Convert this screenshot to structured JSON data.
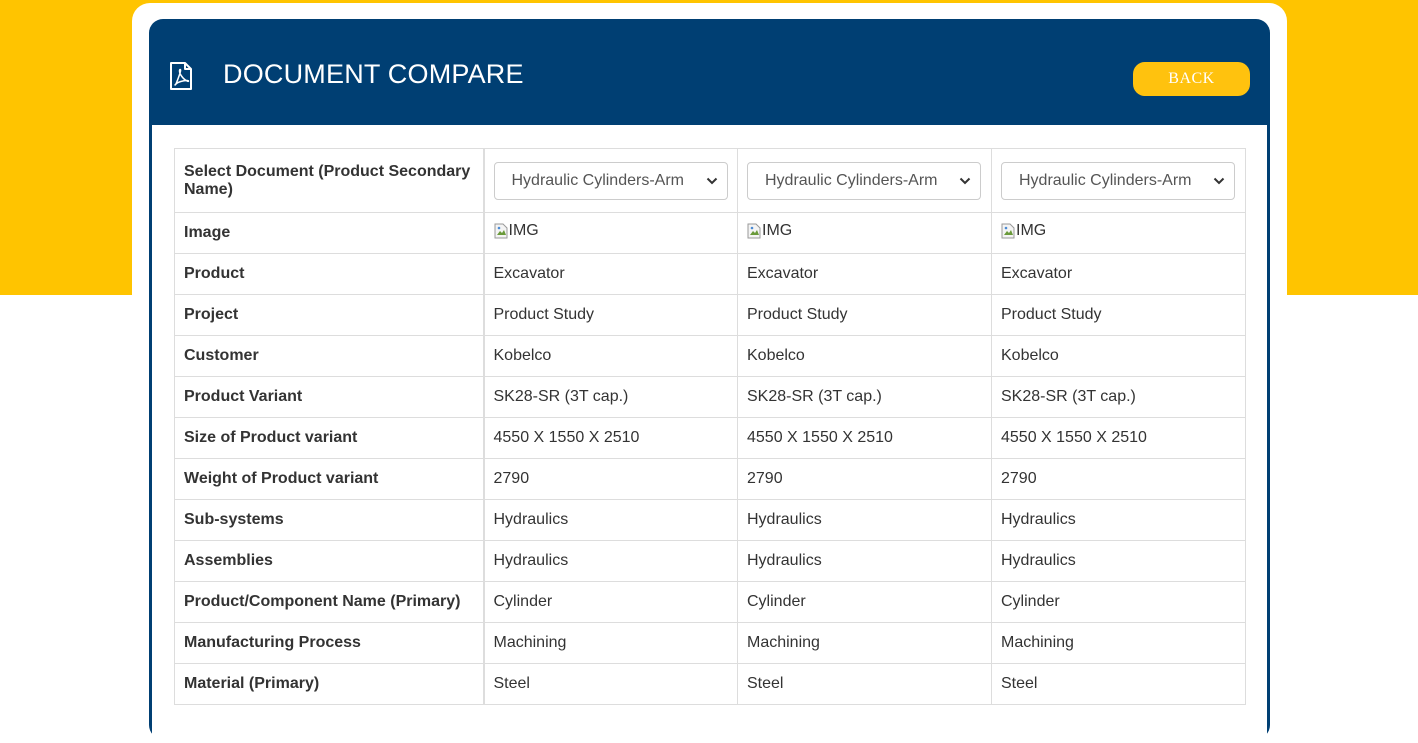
{
  "header": {
    "title": "DOCUMENT COMPARE",
    "back_label": "BACK",
    "icon": "pdf-icon"
  },
  "colors": {
    "background_accent": "#FFC400",
    "header_bg": "#003F73",
    "back_button_bg": "#FFC20E"
  },
  "table": {
    "select_label": "Select Document (Product Secondary Name)",
    "selects": [
      "Hydraulic Cylinders-Arm",
      "Hydraulic Cylinders-Arm",
      "Hydraulic Cylinders-Arm"
    ],
    "image_label": "Image",
    "image_alt": "IMG",
    "rows": [
      {
        "label": "Product",
        "values": [
          "Excavator",
          "Excavator",
          "Excavator"
        ]
      },
      {
        "label": "Project",
        "values": [
          "Product Study",
          "Product Study",
          "Product Study"
        ]
      },
      {
        "label": "Customer",
        "values": [
          "Kobelco",
          "Kobelco",
          "Kobelco"
        ]
      },
      {
        "label": "Product Variant",
        "values": [
          "SK28-SR (3T cap.)",
          "SK28-SR (3T cap.)",
          "SK28-SR (3T cap.)"
        ]
      },
      {
        "label": "Size of Product variant",
        "values": [
          "4550 X 1550 X 2510",
          "4550 X 1550 X 2510",
          "4550 X 1550 X 2510"
        ]
      },
      {
        "label": "Weight of Product variant",
        "values": [
          "2790",
          "2790",
          "2790"
        ]
      },
      {
        "label": "Sub-systems",
        "values": [
          "Hydraulics",
          "Hydraulics",
          "Hydraulics"
        ]
      },
      {
        "label": "Assemblies",
        "values": [
          "Hydraulics",
          "Hydraulics",
          "Hydraulics"
        ]
      },
      {
        "label": "Product/Component Name (Primary)",
        "values": [
          "Cylinder",
          "Cylinder",
          "Cylinder"
        ]
      },
      {
        "label": "Manufacturing Process",
        "values": [
          "Machining",
          "Machining",
          "Machining"
        ]
      },
      {
        "label": "Material (Primary)",
        "values": [
          "Steel",
          "Steel",
          "Steel"
        ]
      }
    ]
  }
}
